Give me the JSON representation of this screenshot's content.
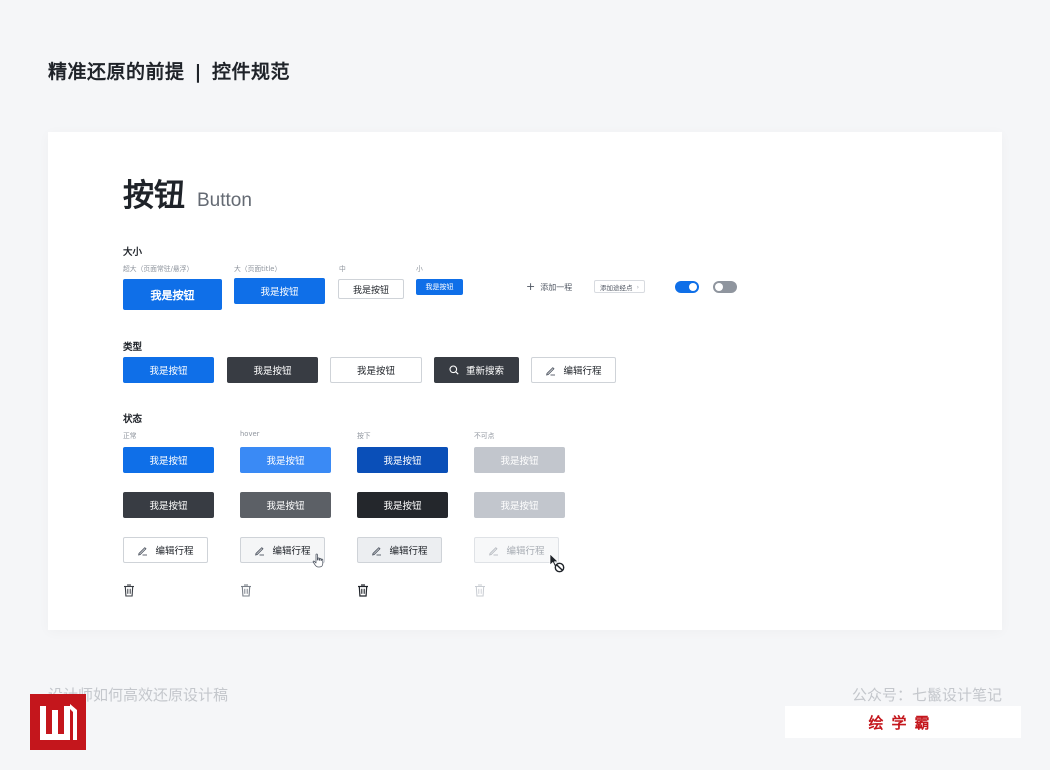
{
  "page": {
    "heading_left": "精准还原的前提",
    "heading_sep": "|",
    "heading_right": "控件规范"
  },
  "title": {
    "cn": "按钮",
    "en": "Button"
  },
  "size_section": {
    "label": "大小",
    "sub_labels": [
      "超大（页面常驻/悬浮）",
      "大（页面title）",
      "中",
      "小"
    ],
    "button_label": "我是按钮",
    "add_link": "添加一程",
    "waypoint_tag": "添加途经点",
    "toggle_on": true,
    "toggle_off": false
  },
  "type_section": {
    "label": "类型",
    "button_label": "我是按钮",
    "search_label": "重新搜索",
    "edit_label": "编辑行程"
  },
  "state_section": {
    "label": "状态",
    "sub_labels": [
      "正常",
      "hover",
      "按下",
      "不可点"
    ],
    "button_label": "我是按钮",
    "edit_label": "编辑行程"
  },
  "footer": {
    "left": "设计师如何高效还原设计稿",
    "right": "公众号：七鬣设计笔记",
    "brand": "绘学霸"
  },
  "colors": {
    "primary": "#0f6fe8",
    "dark": "#383c43",
    "disabled": "#c2c6cd",
    "brand_red": "#c4161c"
  },
  "icons": {
    "search": "search-icon",
    "edit": "pencil-icon",
    "delete": "trash-icon",
    "plus": "plus-icon",
    "hand_cursor": "hand-cursor-icon",
    "not_allowed_cursor": "not-allowed-cursor-icon"
  }
}
